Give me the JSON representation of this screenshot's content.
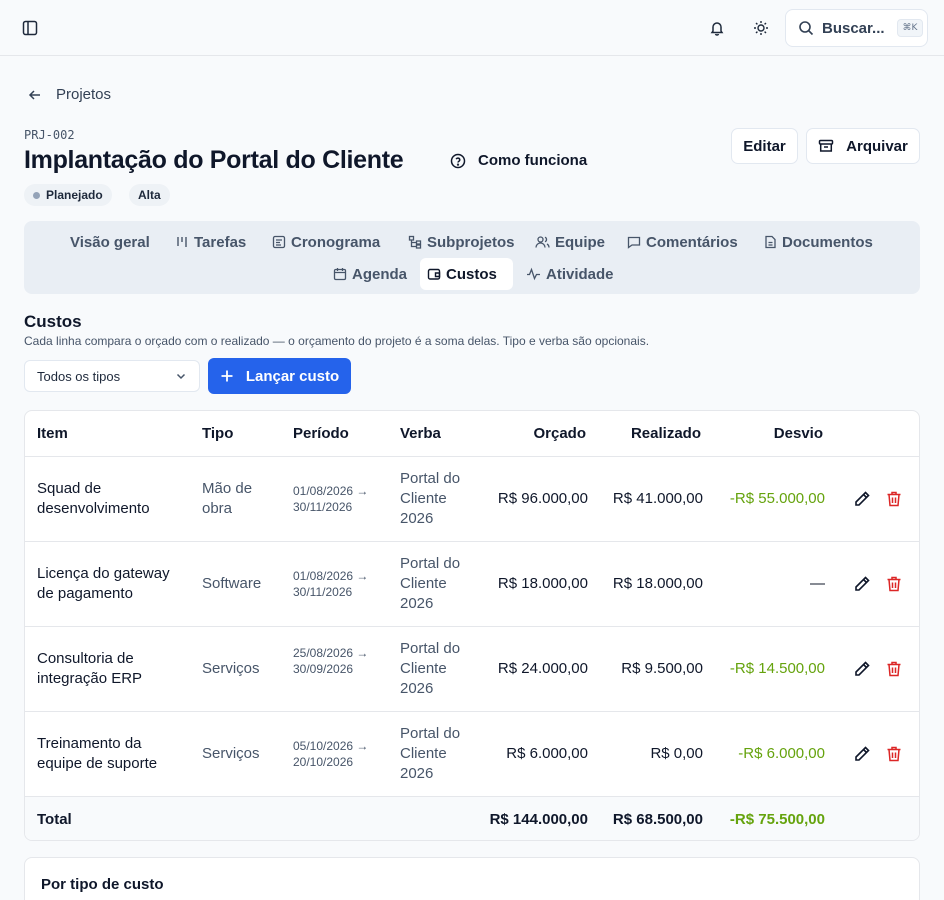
{
  "topbar": {
    "search_label": "Buscar...",
    "search_shortcut": "⌘K",
    "icons": [
      "sidebar-toggle-icon",
      "bell-icon",
      "sun-icon",
      "search-icon"
    ]
  },
  "breadcrumb": {
    "back_label": "Projetos"
  },
  "project": {
    "code": "PRJ-002",
    "title": "Implantação do Portal do Cliente",
    "how_label": "Como funciona",
    "edit_label": "Editar",
    "archive_label": "Arquivar",
    "status": "Planejado",
    "priority": "Alta"
  },
  "tabs": [
    {
      "label": "Visão geral",
      "icon": ""
    },
    {
      "label": "Tarefas",
      "icon": "kanban-icon"
    },
    {
      "label": "Cronograma",
      "icon": "timeline-icon"
    },
    {
      "label": "Subprojetos",
      "icon": "tree-icon"
    },
    {
      "label": "Equipe",
      "icon": "users-icon"
    },
    {
      "label": "Comentários",
      "icon": "comment-icon"
    },
    {
      "label": "Documentos",
      "icon": "file-icon"
    },
    {
      "label": "Agenda",
      "icon": "calendar-icon"
    },
    {
      "label": "Custos",
      "icon": "wallet-icon",
      "active": true
    },
    {
      "label": "Atividade",
      "icon": "activity-icon"
    }
  ],
  "costs": {
    "title": "Custos",
    "description": "Cada linha compara o orçado com o realizado — o orçamento do projeto é a soma delas. Tipo e verba são opcionais.",
    "filter_value": "Todos os tipos",
    "add_label": "Lançar custo",
    "columns": [
      "Item",
      "Tipo",
      "Período",
      "Verba",
      "Orçado",
      "Realizado",
      "Desvio"
    ],
    "rows": [
      {
        "item": "Squad de desenvolvimento",
        "tipo": "Mão de obra",
        "periodo": "01/08/2026 → 30/11/2026",
        "verba": "Portal do Cliente 2026",
        "orcado": "R$ 96.000,00",
        "realizado": "R$ 41.000,00",
        "desvio": "-R$ 55.000,00"
      },
      {
        "item": "Licença do gateway de pagamento",
        "tipo": "Software",
        "periodo": "01/08/2026 → 30/11/2026",
        "verba": "Portal do Cliente 2026",
        "orcado": "R$ 18.000,00",
        "realizado": "R$ 18.000,00",
        "desvio": "—"
      },
      {
        "item": "Consultoria de integração ERP",
        "tipo": "Serviços",
        "periodo": "25/08/2026 → 30/09/2026",
        "verba": "Portal do Cliente 2026",
        "orcado": "R$ 24.000,00",
        "realizado": "R$ 9.500,00",
        "desvio": "-R$ 14.500,00"
      },
      {
        "item": "Treinamento da equipe de suporte",
        "tipo": "Serviços",
        "periodo": "05/10/2026 → 20/10/2026",
        "verba": "Portal do Cliente 2026",
        "orcado": "R$ 6.000,00",
        "realizado": "R$ 0,00",
        "desvio": "-R$ 6.000,00"
      }
    ],
    "total": {
      "label": "Total",
      "orcado": "R$ 144.000,00",
      "realizado": "R$ 68.500,00",
      "desvio": "-R$ 75.500,00"
    }
  },
  "by_type": {
    "title": "Por tipo de custo"
  },
  "colors": {
    "primary": "#2563eb",
    "negative": "#65a30d",
    "danger": "#dc2626"
  }
}
